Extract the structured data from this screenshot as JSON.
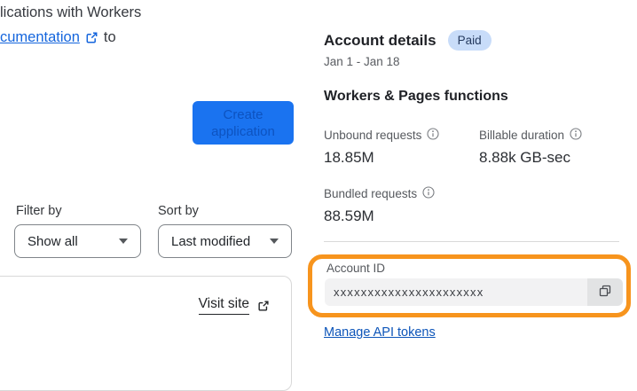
{
  "left": {
    "intro_line1": "lications with Workers",
    "intro_link_text": "cumentation",
    "intro_suffix": "to",
    "create_button_label": "Create application",
    "filter_label": "Filter by",
    "filter_value": "Show all",
    "sort_label": "Sort by",
    "sort_value": "Last modified",
    "visit_site_label": "Visit site"
  },
  "account": {
    "title": "Account details",
    "badge": "Paid",
    "date_range": "Jan 1 - Jan 18",
    "section_title": "Workers & Pages functions",
    "stats": [
      {
        "label": "Unbound requests",
        "value": "18.85M"
      },
      {
        "label": "Billable duration",
        "value": "8.88k GB-sec"
      },
      {
        "label": "Bundled requests",
        "value": "88.59M"
      }
    ],
    "account_id_label": "Account ID",
    "account_id_value": "xxxxxxxxxxxxxxxxxxxxxx",
    "manage_link": "Manage API tokens"
  },
  "icons": {
    "external_link": "external-link-icon",
    "info": "info-icon",
    "copy": "copy-icon",
    "caret": "chevron-down-icon"
  },
  "colors": {
    "button_blue": "#1a73f0",
    "button_text_blue": "#0d53c0",
    "badge_bg": "#c8dcf9",
    "badge_text": "#253a5f",
    "intro_link_blue": "#1465dd",
    "manage_link_blue": "#0d55b9",
    "highlight_orange": "#f7941d"
  }
}
